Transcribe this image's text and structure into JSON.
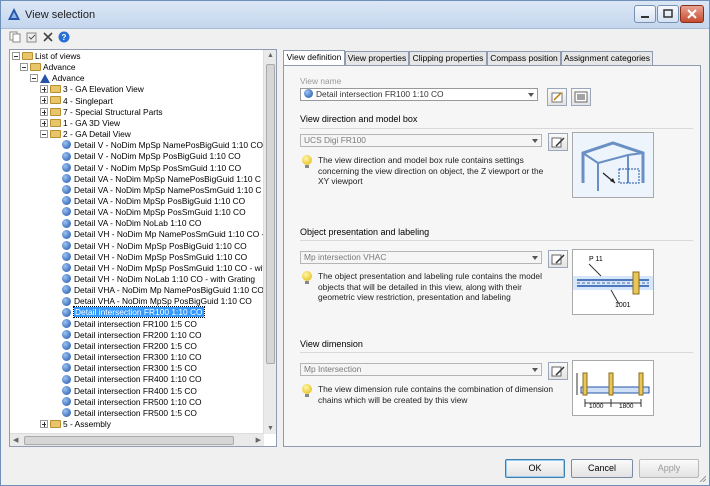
{
  "window": {
    "title": "View selection"
  },
  "toolbar": {
    "icons": [
      "copy-icon",
      "paste-icon",
      "delete-icon",
      "help-icon"
    ]
  },
  "tree": {
    "rows": [
      {
        "level": 0,
        "type": "folder",
        "expand": "minus",
        "label": "List of views"
      },
      {
        "level": 1,
        "type": "folder",
        "expand": "minus",
        "label": "Advance"
      },
      {
        "level": 2,
        "type": "app",
        "expand": "minus",
        "label": "Advance"
      },
      {
        "level": 3,
        "type": "folder",
        "expand": "plus",
        "label": "3 - GA Elevation View"
      },
      {
        "level": 3,
        "type": "folder",
        "expand": "plus",
        "label": "4 - Singlepart"
      },
      {
        "level": 3,
        "type": "folder",
        "expand": "plus",
        "label": "7 - Special Structural Parts"
      },
      {
        "level": 3,
        "type": "folder",
        "expand": "plus",
        "label": "1 - GA 3D View"
      },
      {
        "level": 3,
        "type": "folder",
        "expand": "minus",
        "label": "2 - GA Detail View"
      },
      {
        "level": 4,
        "type": "view",
        "label": "Detail V - NoDim MpSp NamePosBigGuid 1:10 CO"
      },
      {
        "level": 4,
        "type": "view",
        "label": "Detail V - NoDim MpSp PosBigGuid 1:10 CO"
      },
      {
        "level": 4,
        "type": "view",
        "label": "Detail V - NoDim MpSp PosSmGuid 1:10 CO"
      },
      {
        "level": 4,
        "type": "view",
        "label": "Detail VA - NoDim MpSp NamePosBigGuid 1:10 C"
      },
      {
        "level": 4,
        "type": "view",
        "label": "Detail VA - NoDim MpSp NamePosSmGuid 1:10 C"
      },
      {
        "level": 4,
        "type": "view",
        "label": "Detail VA - NoDim MpSp PosBigGuid 1:10 CO"
      },
      {
        "level": 4,
        "type": "view",
        "label": "Detail VA - NoDim MpSp PosSmGuid 1:10 CO"
      },
      {
        "level": 4,
        "type": "view",
        "label": "Detail VA - NoDim NoLab 1:10 CO"
      },
      {
        "level": 4,
        "type": "view",
        "label": "Detail VH - NoDim Mp NamePosSmGuid 1:10 CO -"
      },
      {
        "level": 4,
        "type": "view",
        "label": "Detail VH - NoDim MpSp PosBigGuid 1:10 CO"
      },
      {
        "level": 4,
        "type": "view",
        "label": "Detail VH - NoDim MpSp PosSmGuid 1:10 CO"
      },
      {
        "level": 4,
        "type": "view",
        "label": "Detail VH - NoDim MpSp PosSmGuid 1:10 CO - with"
      },
      {
        "level": 4,
        "type": "view",
        "label": "Detail VH - NoDim NoLab 1:10 CO - with Grating"
      },
      {
        "level": 4,
        "type": "view",
        "label": "Detail VHA - NoDim Mp NamePosBigGuid 1:10 CO"
      },
      {
        "level": 4,
        "type": "view",
        "label": "Detail VHA - NoDim MpSp PosBigGuid 1:10 CO"
      },
      {
        "level": 4,
        "type": "view",
        "label": "Detail intersection FR100 1:10 CO",
        "selected": true
      },
      {
        "level": 4,
        "type": "view",
        "label": "Detail intersection FR100 1:5 CO"
      },
      {
        "level": 4,
        "type": "view",
        "label": "Detail intersection FR200 1:10 CO"
      },
      {
        "level": 4,
        "type": "view",
        "label": "Detail intersection FR200 1:5 CO"
      },
      {
        "level": 4,
        "type": "view",
        "label": "Detail intersection FR300 1:10 CO"
      },
      {
        "level": 4,
        "type": "view",
        "label": "Detail intersection FR300 1:5 CO"
      },
      {
        "level": 4,
        "type": "view",
        "label": "Detail intersection FR400 1:10 CO"
      },
      {
        "level": 4,
        "type": "view",
        "label": "Detail intersection FR400 1:5 CO"
      },
      {
        "level": 4,
        "type": "view",
        "label": "Detail intersection FR500 1:10 CO"
      },
      {
        "level": 4,
        "type": "view",
        "label": "Detail intersection FR500 1:5 CO"
      },
      {
        "level": 3,
        "type": "folder",
        "expand": "plus",
        "label": "5 - Assembly"
      }
    ]
  },
  "tabs": [
    "View definition",
    "View properties",
    "Clipping properties",
    "Compass position",
    "Assignment categories"
  ],
  "active_tab": 0,
  "view_definition": {
    "view_name_label": "View name",
    "view_name_value": "Detail intersection FR100 1:10 CO",
    "sections": [
      {
        "heading": "View direction and model box",
        "combo": "UCS Digi FR100",
        "description": "The view direction and model box rule contains settings concerning the view direction on object, the Z viewport or the XY viewport"
      },
      {
        "heading": "Object presentation and labeling",
        "combo": "Mp intersection VHAC",
        "description": "The object presentation and labeling rule contains the model objects that will be detailed in this view, along with their geometric view restriction, presentation and labeling",
        "image_labels": [
          "P 11",
          "1001"
        ]
      },
      {
        "heading": "View dimension",
        "combo": "Mp Intersection",
        "description": "The view dimension rule contains the combination of dimension chains which will be created by this view",
        "image_labels": [
          "1000",
          "1800"
        ]
      }
    ]
  },
  "buttons": {
    "ok": "OK",
    "cancel": "Cancel",
    "apply": "Apply"
  }
}
